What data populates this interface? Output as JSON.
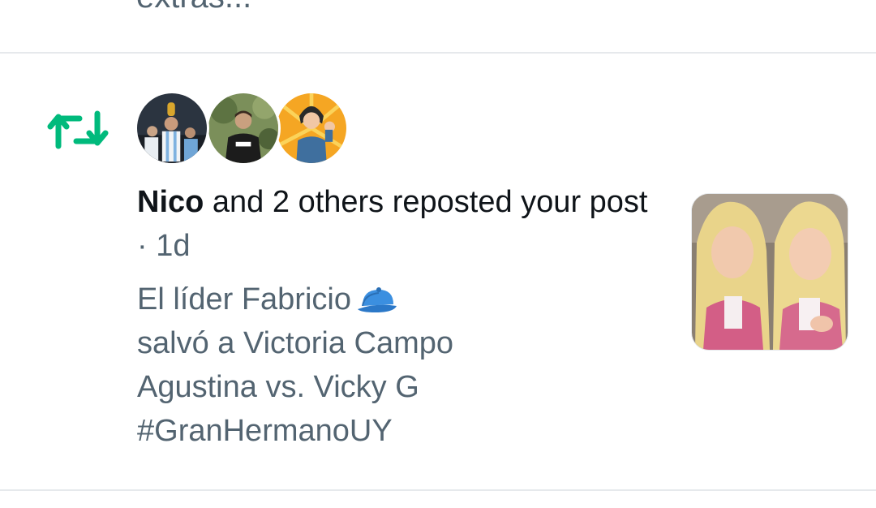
{
  "previous_notification": {
    "text_fragment": "extras..."
  },
  "notification": {
    "type_icon": "repost-icon",
    "accent_color": "#00ba7c",
    "avatars": [
      {
        "name": "avatar-user-1"
      },
      {
        "name": "avatar-user-2"
      },
      {
        "name": "avatar-user-3"
      }
    ],
    "actor": "Nico",
    "action_text": " and 2 others reposted your post",
    "separator": " · ",
    "time": "1d",
    "post_lines": [
      "El líder Fabricio",
      "salvó a Victoria Campo",
      "Agustina vs. Vicky G",
      "#GranHermanoUY"
    ],
    "post_emoji": "billed-cap-icon"
  }
}
